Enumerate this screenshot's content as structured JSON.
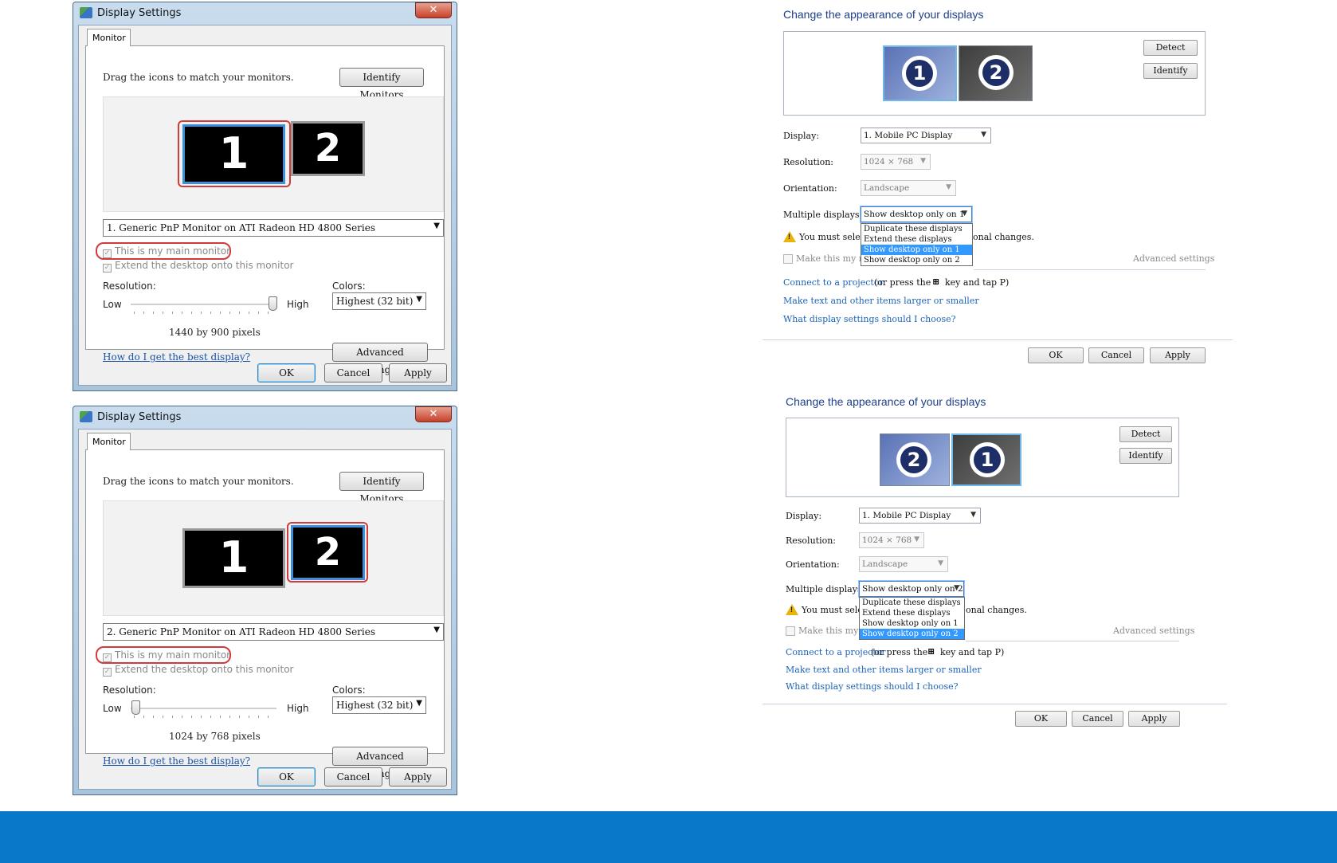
{
  "vista_dialogs": [
    {
      "title": "Display Settings",
      "close_glyph": "✕",
      "tab": "Monitor",
      "instruction": "Drag the icons to match your monitors.",
      "identify_button": "Identify Monitors",
      "monitors": [
        "1",
        "2"
      ],
      "selected_monitor": "1",
      "display_select": "1. Generic PnP Monitor on ATI Radeon HD 4800 Series",
      "main_monitor_checkbox": "This is my main monitor",
      "extend_checkbox": "Extend the desktop onto this monitor",
      "resolution_label": "Resolution:",
      "low": "Low",
      "high": "High",
      "slider_level": 1.0,
      "resolution_value": "1440 by 900 pixels",
      "colors_label": "Colors:",
      "colors_select": "Highest (32 bit)",
      "help_link": "How do I get the best display?",
      "advanced_button": "Advanced Settings...",
      "ok": "OK",
      "cancel": "Cancel",
      "apply": "Apply"
    },
    {
      "title": "Display Settings",
      "close_glyph": "✕",
      "tab": "Monitor",
      "instruction": "Drag the icons to match your monitors.",
      "identify_button": "Identify Monitors",
      "monitors": [
        "1",
        "2"
      ],
      "selected_monitor": "2",
      "display_select": "2. Generic PnP Monitor on ATI Radeon HD 4800 Series",
      "main_monitor_checkbox": "This is my main monitor",
      "extend_checkbox": "Extend the desktop onto this monitor",
      "resolution_label": "Resolution:",
      "low": "Low",
      "high": "High",
      "slider_level": 0.0,
      "resolution_value": "1024 by 768 pixels",
      "colors_label": "Colors:",
      "colors_select": "Highest (32 bit)",
      "help_link": "How do I get the best display?",
      "advanced_button": "Advanced Settings...",
      "ok": "OK",
      "cancel": "Cancel",
      "apply": "Apply"
    }
  ],
  "win7_panels": [
    {
      "heading": "Change the appearance of your displays",
      "monitor_order": [
        "1",
        "2"
      ],
      "detect": "Detect",
      "identify": "Identify",
      "display_label": "Display:",
      "display_value": "1. Mobile PC Display",
      "resolution_label": "Resolution:",
      "resolution_value": "1024 × 768",
      "orientation_label": "Orientation:",
      "orientation_value": "Landscape",
      "multiple_label": "Multiple displays:",
      "multiple_value": "Show desktop only on 1",
      "dropdown_options": [
        "Duplicate these displays",
        "Extend these displays",
        "Show desktop only on 1",
        "Show desktop only on 2"
      ],
      "dropdown_selected": 2,
      "warning_left": "You must select",
      "warning_right": "onal changes.",
      "make_main_partial": "Make this my ma",
      "advanced_link": "Advanced settings",
      "projector_link": "Connect to a projector",
      "projector_text_a": "(or press the",
      "projector_text_b": "key and tap P)",
      "link_text_size": "Make text and other items larger or smaller",
      "link_choose": "What display settings should I choose?",
      "ok": "OK",
      "cancel": "Cancel",
      "apply": "Apply"
    },
    {
      "heading": "Change the appearance of your displays",
      "monitor_order": [
        "2",
        "1"
      ],
      "detect": "Detect",
      "identify": "Identify",
      "display_label": "Display:",
      "display_value": "1. Mobile PC Display",
      "resolution_label": "Resolution:",
      "resolution_value": "1024 × 768",
      "orientation_label": "Orientation:",
      "orientation_value": "Landscape",
      "multiple_label": "Multiple displays:",
      "multiple_value": "Show desktop only on 2",
      "dropdown_options": [
        "Duplicate these displays",
        "Extend these displays",
        "Show desktop only on 1",
        "Show desktop only on 2"
      ],
      "dropdown_selected": 3,
      "warning_left": "You must select",
      "warning_right": "onal changes.",
      "make_main_partial": "Make this my ma",
      "advanced_link": "Advanced settings",
      "projector_link": "Connect to a projector",
      "projector_text_a": "(or press the",
      "projector_text_b": "key and tap P)",
      "link_text_size": "Make text and other items larger or smaller",
      "link_choose": "What display settings should I choose?",
      "ok": "OK",
      "cancel": "Cancel",
      "apply": "Apply"
    }
  ],
  "colors": {
    "footer_band": "#0a78c8",
    "highlight_oval": "#d23b3b",
    "dropdown_highlight": "#3399ff",
    "heading_blue": "#1e3f8a"
  },
  "icons": {
    "app": "display-settings-icon",
    "close": "close-icon",
    "warning": "warning-icon",
    "windows_key": "windows-logo-icon"
  }
}
